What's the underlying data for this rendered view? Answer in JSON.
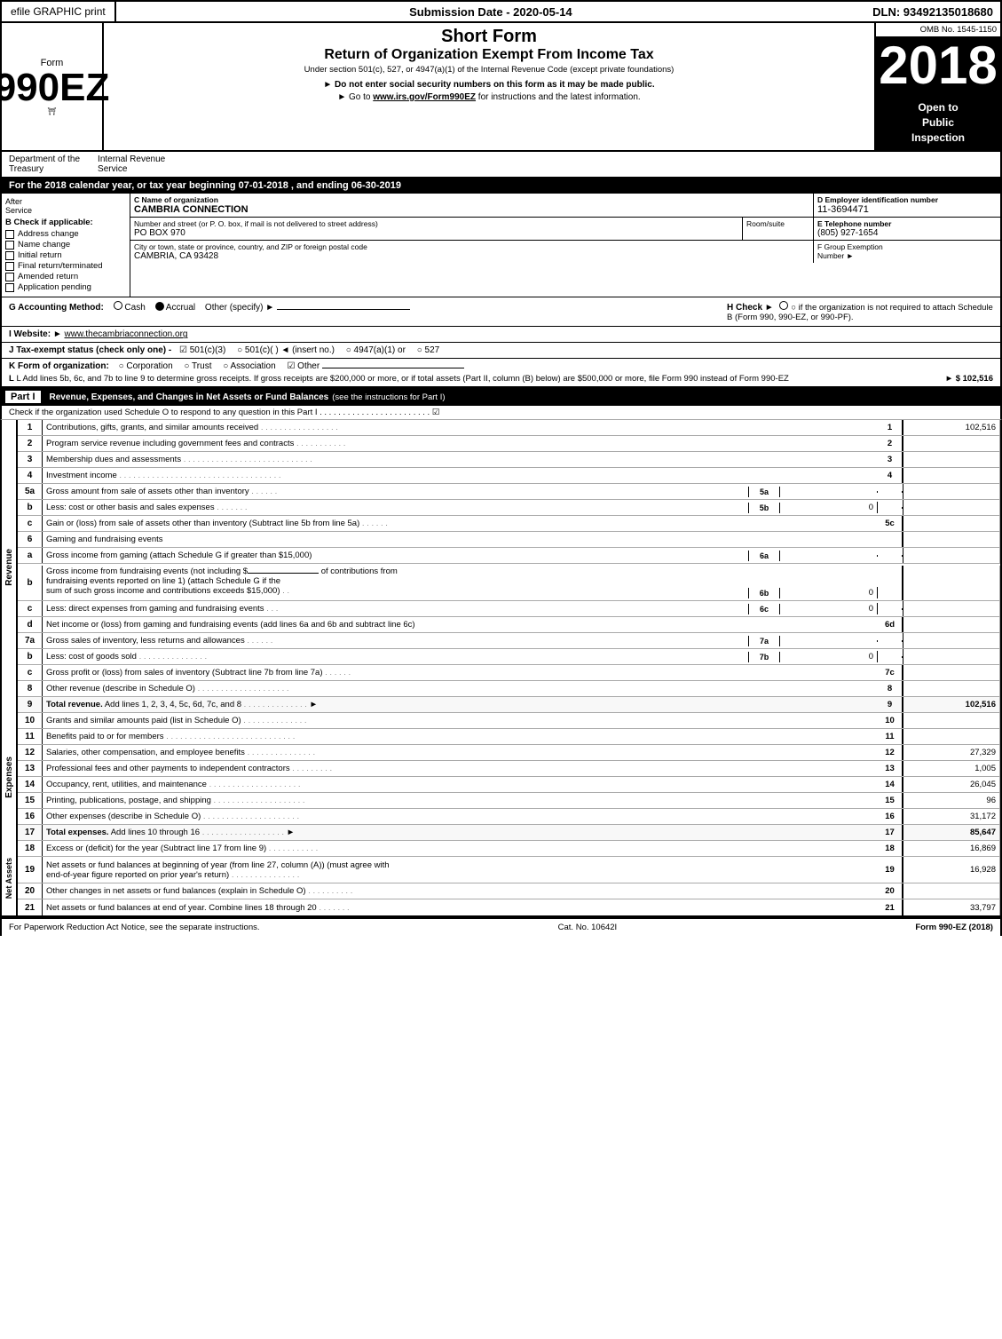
{
  "topbar": {
    "left": "efile GRAPHIC print",
    "mid": "Submission Date - 2020-05-14",
    "right": "DLN: 93492135018680"
  },
  "form": {
    "number": "990EZ",
    "name": "Form",
    "short_form": "Short Form",
    "return_title": "Return of Organization Exempt From Income Tax",
    "subtitle": "Under section 501(c), 527, or 4947(a)(1) of the Internal Revenue Code (except private foundations)",
    "notice1": "► Do not enter social security numbers on this form as it may be made public.",
    "notice2": "► Go to www.irs.gov/Form990EZ for instructions and the latest information.",
    "omb": "OMB No. 1545-1150",
    "year": "2018",
    "open_to_public": "Open to\nPublic\nInspection",
    "dept": "Department of the\nTreasury",
    "internal_revenue": "Internal Revenue\nService",
    "tax_year_bar": "For the 2018 calendar year, or tax year beginning 07-01-2018        , and ending 06-30-2019"
  },
  "checks": {
    "after_label": "After",
    "service_label": "Service",
    "check_label": "B Check if applicable:",
    "items": [
      "Address change",
      "Name change",
      "Initial return",
      "Final return/terminated",
      "Amended return",
      "Application pending"
    ]
  },
  "org_info": {
    "c_label": "C Name of organization",
    "c_value": "CAMBRIA CONNECTION",
    "address_label": "Number and street (or P. O. box, if mail is not delivered to street address)",
    "address_value": "PO BOX 970",
    "room_label": "Room/suite",
    "room_value": "",
    "city_label": "City or town, state or province, country, and ZIP or foreign postal code",
    "city_value": "CAMBRIA, CA  93428",
    "d_label": "D Employer identification number",
    "d_value": "11-3694471",
    "e_label": "E Telephone number",
    "e_value": "(805) 927-1654",
    "f_label": "F Group Exemption\nNumber",
    "f_value": ""
  },
  "accounting": {
    "g_label": "G Accounting Method:",
    "cash": "Cash",
    "accrual": "Accrual",
    "other": "Other (specify) ►",
    "accrual_checked": true,
    "h_label": "H Check ►",
    "h_desc": "○ if the organization is not required to attach Schedule B (Form 990, 990-EZ, or 990-PF)."
  },
  "website": {
    "i_label": "I Website: ►",
    "i_value": "www.thecambriaconnection.org"
  },
  "tax_status": {
    "j_label": "J Tax-exempt status (check only one) -",
    "options": [
      "☑ 501(c)(3)",
      "○ 501(c)(  ) ◄ (insert no.)",
      "○ 4947(a)(1) or",
      "○ 527"
    ]
  },
  "k_line": {
    "label": "K Form of organization:",
    "options": [
      "○ Corporation",
      "○ Trust",
      "○ Association",
      "☑ Other"
    ]
  },
  "l_line": {
    "text": "L Add lines 5b, 6c, and 7b to line 9 to determine gross receipts. If gross receipts are $200,000 or more, or if total assets (Part II, column (B) below) are $500,000 or more, file Form 990 instead of Form 990-EZ",
    "amount": "► $ 102,516"
  },
  "part1": {
    "label": "Part I",
    "title": "Revenue, Expenses, and Changes in Net Assets or Fund Balances",
    "subtitle": "(see the instructions for Part I)",
    "check_line": "Check if the organization used Schedule O to respond to any question in this Part I . . . . . . . . . . . . . . . . . . . . . . . . ☑",
    "lines": [
      {
        "num": "1",
        "desc": "Contributions, gifts, grants, and similar amounts received",
        "dots": true,
        "amount": "102,516",
        "col": "1"
      },
      {
        "num": "2",
        "desc": "Program service revenue including government fees and contracts",
        "dots": true,
        "amount": "",
        "col": "2"
      },
      {
        "num": "3",
        "desc": "Membership dues and assessments",
        "dots": true,
        "amount": "",
        "col": "3"
      },
      {
        "num": "4",
        "desc": "Investment income",
        "dots": true,
        "amount": "",
        "col": "4"
      },
      {
        "num": "5a",
        "desc": "Gross amount from sale of assets other than inventory",
        "ref": "5a",
        "amount": ""
      },
      {
        "num": "5b",
        "desc": "Less: cost or other basis and sales expenses",
        "ref": "5b",
        "amount": "0"
      },
      {
        "num": "5c",
        "desc": "Gain or (loss) from sale of assets other than inventory (Subtract line 5b from line 5a)",
        "dots": true,
        "amount": "",
        "col": "5c"
      },
      {
        "num": "6",
        "desc": "Gaming and fundraising events",
        "amount": ""
      },
      {
        "num": "6a",
        "sub": true,
        "desc": "Gross income from gaming (attach Schedule G if greater than $15,000)",
        "ref": "6a",
        "amount": ""
      },
      {
        "num": "6b",
        "sub": true,
        "desc": "Gross income from fundraising events (not including $_____ of contributions from fundraising events reported on line 1) (attach Schedule G if the sum of such gross income and contributions exceeds $15,000)",
        "ref": "6b",
        "amount": "0"
      },
      {
        "num": "6c",
        "sub": true,
        "desc": "Less: direct expenses from gaming and fundraising events",
        "ref": "6c",
        "amount": "0"
      },
      {
        "num": "6d",
        "sub": true,
        "desc": "Net income or (loss) from gaming and fundraising events (add lines 6a and 6b and subtract line 6c)",
        "col": "6d",
        "amount": ""
      },
      {
        "num": "7a",
        "desc": "Gross sales of inventory, less returns and allowances",
        "ref": "7a",
        "amount": ""
      },
      {
        "num": "7b",
        "desc": "Less: cost of goods sold",
        "ref": "7b",
        "amount": "0"
      },
      {
        "num": "7c",
        "desc": "Gross profit or (loss) from sales of inventory (Subtract line 7b from line 7a)",
        "dots": true,
        "col": "7c",
        "amount": ""
      },
      {
        "num": "8",
        "desc": "Other revenue (describe in Schedule O)",
        "dots": true,
        "col": "8",
        "amount": ""
      },
      {
        "num": "9",
        "desc": "Total revenue. Add lines 1, 2, 3, 4, 5c, 6d, 7c, and 8",
        "dots": true,
        "arrow": true,
        "col": "9",
        "amount": "102,516",
        "total": true
      }
    ]
  },
  "expenses_lines": [
    {
      "num": "10",
      "desc": "Grants and similar amounts paid (list in Schedule O)",
      "dots": true,
      "col": "10",
      "amount": ""
    },
    {
      "num": "11",
      "desc": "Benefits paid to or for members",
      "dots": true,
      "col": "11",
      "amount": ""
    },
    {
      "num": "12",
      "desc": "Salaries, other compensation, and employee benefits",
      "dots": true,
      "col": "12",
      "amount": "27,329"
    },
    {
      "num": "13",
      "desc": "Professional fees and other payments to independent contractors",
      "dots": true,
      "col": "13",
      "amount": "1,005"
    },
    {
      "num": "14",
      "desc": "Occupancy, rent, utilities, and maintenance",
      "dots": true,
      "col": "14",
      "amount": "26,045"
    },
    {
      "num": "15",
      "desc": "Printing, publications, postage, and shipping",
      "dots": true,
      "col": "15",
      "amount": "96"
    },
    {
      "num": "16",
      "desc": "Other expenses (describe in Schedule O)",
      "dots": true,
      "col": "16",
      "amount": "31,172"
    },
    {
      "num": "17",
      "desc": "Total expenses. Add lines 10 through 16",
      "dots": true,
      "arrow": true,
      "col": "17",
      "amount": "85,647",
      "total": true
    }
  ],
  "net_assets_lines": [
    {
      "num": "18",
      "desc": "Excess or (deficit) for the year (Subtract line 17 from line 9)",
      "dots": true,
      "col": "18",
      "amount": "16,869"
    },
    {
      "num": "19",
      "desc": "Net assets or fund balances at beginning of year (from line 27, column (A)) (must agree with end-of-year figure reported on prior year's return)",
      "dots": true,
      "col": "19",
      "amount": "16,928"
    },
    {
      "num": "20",
      "desc": "Other changes in net assets or fund balances (explain in Schedule O)",
      "dots": true,
      "col": "20",
      "amount": ""
    },
    {
      "num": "21",
      "desc": "Net assets or fund balances at end of year. Combine lines 18 through 20",
      "dots": true,
      "col": "21",
      "amount": "33,797"
    }
  ],
  "footer": {
    "left": "For Paperwork Reduction Act Notice, see the separate instructions.",
    "mid": "Cat. No. 10642I",
    "right": "Form 990-EZ (2018)"
  }
}
